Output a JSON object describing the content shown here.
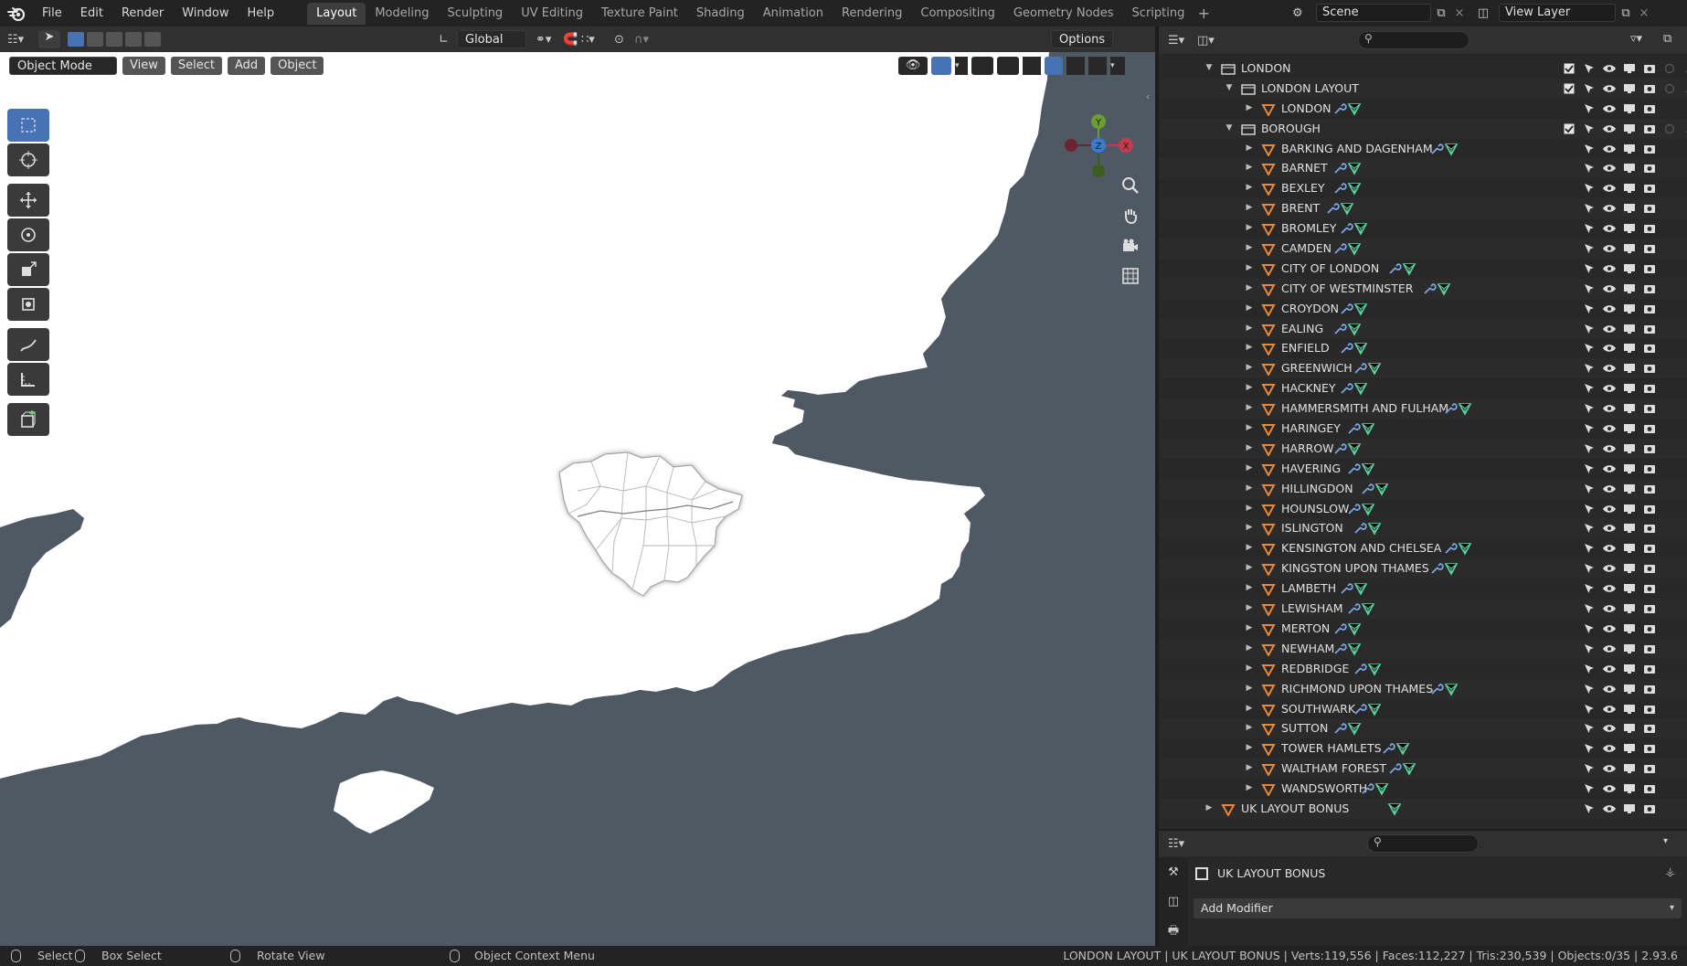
{
  "menu": [
    "File",
    "Edit",
    "Render",
    "Window",
    "Help"
  ],
  "workspaces": [
    "Layout",
    "Modeling",
    "Sculpting",
    "UV Editing",
    "Texture Paint",
    "Shading",
    "Animation",
    "Rendering",
    "Compositing",
    "Geometry Nodes",
    "Scripting"
  ],
  "active_workspace": "Layout",
  "scene": {
    "label": "Scene",
    "view_layer": "View Layer"
  },
  "viewport": {
    "transform_orientation": "Global",
    "options_label": "Options",
    "mode": "Object Mode",
    "menus": [
      "View",
      "Select",
      "Add",
      "Object"
    ],
    "gizmo": {
      "y": "Y",
      "z": "Z",
      "x": "X"
    },
    "colors": {
      "background": "#4f5963",
      "land": "#ffffff",
      "accent": "#4772b3"
    }
  },
  "outliner": {
    "root": "LONDON",
    "layout_collection": "LONDON LAYOUT",
    "layout_object": "LONDON",
    "borough_collection": "BOROUGH",
    "boroughs": [
      "BARKING AND DAGENHAM",
      "BARNET",
      "BEXLEY",
      "BRENT",
      "BROMLEY",
      "CAMDEN",
      "CITY OF LONDON",
      "CITY OF WESTMINSTER",
      "CROYDON",
      "EALING",
      "ENFIELD",
      "GREENWICH",
      "HACKNEY",
      "HAMMERSMITH AND FULHAM",
      "HARINGEY",
      "HARROW",
      "HAVERING",
      "HILLINGDON",
      "HOUNSLOW",
      "ISLINGTON",
      "KENSINGTON AND CHELSEA",
      "KINGSTON UPON THAMES",
      "LAMBETH",
      "LEWISHAM",
      "MERTON",
      "NEWHAM",
      "REDBRIDGE",
      "RICHMOND UPON THAMES",
      "SOUTHWARK",
      "SUTTON",
      "TOWER HAMLETS",
      "WALTHAM FOREST",
      "WANDSWORTH"
    ],
    "bonus_object": "UK LAYOUT BONUS"
  },
  "properties": {
    "object_name": "UK LAYOUT BONUS",
    "add_modifier": "Add Modifier"
  },
  "status": {
    "select": "Select",
    "box_select": "Box Select",
    "rotate_view": "Rotate View",
    "context_menu": "Object Context Menu",
    "stats": "LONDON LAYOUT | UK LAYOUT BONUS | Verts:119,556 | Faces:112,227 | Tris:230,539 | Objects:0/35 | 2.93.6"
  }
}
